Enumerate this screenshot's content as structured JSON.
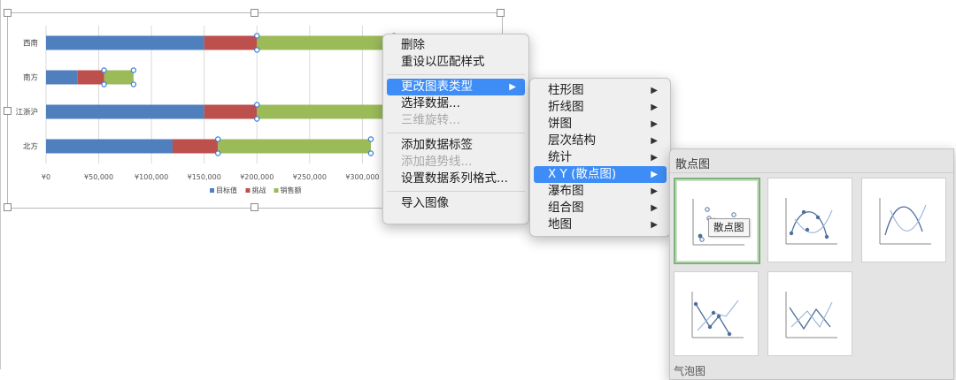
{
  "chart_data": {
    "type": "bar",
    "orientation": "horizontal",
    "stacked": true,
    "categories": [
      "北方",
      "江浙沪",
      "南方",
      "西南"
    ],
    "series": [
      {
        "name": "目标值",
        "values": [
          120000,
          150000,
          30000,
          150000
        ],
        "color": "#4f7fbd"
      },
      {
        "name": "挑战",
        "values": [
          43000,
          50000,
          25000,
          50000
        ],
        "color": "#bd4f4c"
      },
      {
        "name": "销售额",
        "values": [
          145000,
          130000,
          28000,
          130000
        ],
        "color": "#9bbb59"
      }
    ],
    "x_ticks": [
      "¥0",
      "¥50,000",
      "¥100,000",
      "¥150,000",
      "¥200,000",
      "¥250,000",
      "¥300,000"
    ],
    "xlim": [
      0,
      350000
    ],
    "grid": true,
    "legend_position": "bottom",
    "selected_series": "销售额"
  },
  "context_menu": {
    "items": [
      {
        "label": "删除",
        "disabled": false
      },
      {
        "label": "重设以匹配样式",
        "disabled": false
      },
      {
        "separator": true
      },
      {
        "label": "更改图表类型",
        "disabled": false,
        "submenu": true,
        "active": true
      },
      {
        "label": "选择数据...",
        "disabled": false
      },
      {
        "label": "三维旋转...",
        "disabled": true
      },
      {
        "separator": true
      },
      {
        "label": "添加数据标签",
        "disabled": false
      },
      {
        "label": "添加趋势线...",
        "disabled": true
      },
      {
        "label": "设置数据系列格式...",
        "disabled": false
      },
      {
        "separator": true
      },
      {
        "label": "导入图像",
        "disabled": false
      }
    ]
  },
  "chart_type_menu": {
    "items": [
      {
        "label": "柱形图",
        "submenu": true
      },
      {
        "label": "折线图",
        "submenu": true
      },
      {
        "label": "饼图",
        "submenu": true
      },
      {
        "label": "层次结构",
        "submenu": true
      },
      {
        "label": "统计",
        "submenu": true
      },
      {
        "label": "X Y (散点图)",
        "submenu": true,
        "active": true
      },
      {
        "label": "瀑布图",
        "submenu": true
      },
      {
        "label": "组合图",
        "submenu": true
      },
      {
        "label": "地图",
        "submenu": true
      }
    ]
  },
  "scatter_gallery": {
    "header": "散点图",
    "tooltip": "散点图",
    "next_section": "气泡图",
    "tiles": [
      {
        "name": "scatter-markers-only",
        "selected": true
      },
      {
        "name": "scatter-smooth-lines-markers",
        "selected": false
      },
      {
        "name": "scatter-smooth-lines",
        "selected": false
      },
      {
        "name": "scatter-straight-lines-markers",
        "selected": false
      },
      {
        "name": "scatter-straight-lines",
        "selected": false
      }
    ]
  }
}
